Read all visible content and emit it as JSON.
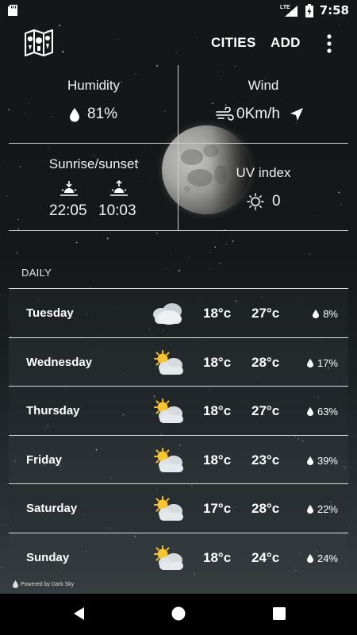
{
  "status_bar": {
    "time": "7:58",
    "network": "LTE",
    "icons": [
      "sd-card-icon",
      "lte-signal-icon",
      "battery-charging-icon"
    ]
  },
  "app_bar": {
    "logo_icon": "map-logo-icon",
    "cities_label": "CITIES",
    "add_label": "ADD",
    "menu_icon": "more-vert-icon"
  },
  "current": {
    "humidity_title": "Humidity",
    "humidity_value": "81%",
    "wind_title": "Wind",
    "wind_value": "0Km/h",
    "sunrise_title": "Sunrise/sunset",
    "sunrise_time": "22:05",
    "sunset_time": "10:03",
    "uv_title": "UV index",
    "uv_value": "0"
  },
  "daily": {
    "label": "DAILY",
    "days": [
      {
        "day": "Tuesday",
        "icon": "cloudy-icon",
        "min": "18°c",
        "max": "27°c",
        "precip": "8%"
      },
      {
        "day": "Wednesday",
        "icon": "partly-cloudy-icon",
        "min": "18°c",
        "max": "28°c",
        "precip": "17%"
      },
      {
        "day": "Thursday",
        "icon": "partly-cloudy-icon",
        "min": "18°c",
        "max": "27°c",
        "precip": "63%"
      },
      {
        "day": "Friday",
        "icon": "partly-cloudy-icon",
        "min": "18°c",
        "max": "23°c",
        "precip": "39%"
      },
      {
        "day": "Saturday",
        "icon": "partly-cloudy-icon",
        "min": "17°c",
        "max": "28°c",
        "precip": "22%"
      },
      {
        "day": "Sunday",
        "icon": "partly-cloudy-icon",
        "min": "18°c",
        "max": "24°c",
        "precip": "24%"
      }
    ]
  },
  "footer": {
    "powered_by": "Powered by Dark Sky"
  },
  "nav_bar": {
    "buttons": [
      "back-icon",
      "home-icon",
      "recents-icon"
    ]
  },
  "colors": {
    "background_top": "#141617",
    "background_bottom": "#3b4446",
    "text": "#ffffff",
    "nav_bar": "#000000"
  }
}
